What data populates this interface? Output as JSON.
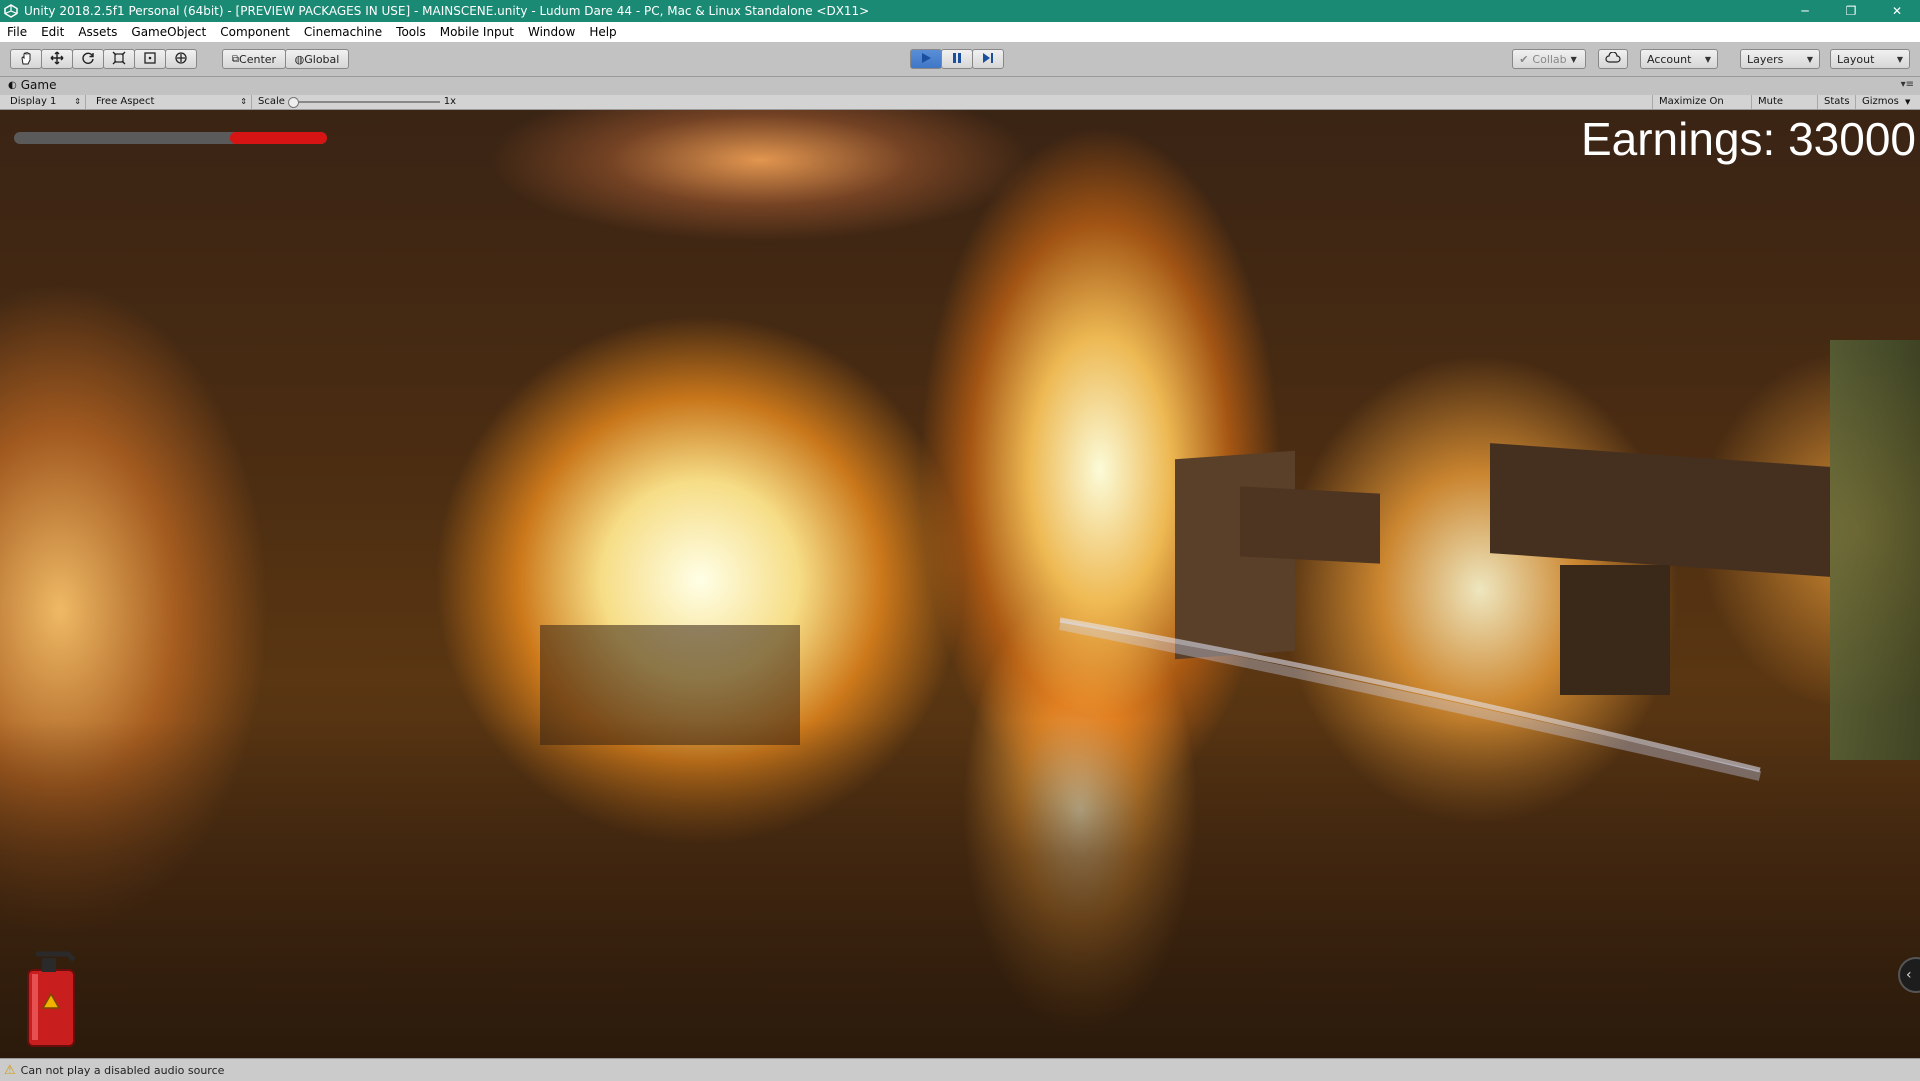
{
  "window": {
    "title": "Unity 2018.2.5f1 Personal (64bit) - [PREVIEW PACKAGES IN USE] - MAINSCENE.unity - Ludum Dare 44 - PC, Mac & Linux Standalone <DX11>",
    "minimize_glyph": "─",
    "restore_glyph": "❐",
    "close_glyph": "✕"
  },
  "menu": [
    "File",
    "Edit",
    "Assets",
    "GameObject",
    "Component",
    "Cinemachine",
    "Tools",
    "Mobile Input",
    "Window",
    "Help"
  ],
  "toolbar": {
    "pivot_label": "Center",
    "space_label": "Global",
    "collab_label": "Collab",
    "account_label": "Account",
    "layers_label": "Layers",
    "layout_label": "Layout",
    "play_state": "playing",
    "play_color": "#3f77c7"
  },
  "game_view": {
    "tab_label": "Game",
    "display": "Display 1",
    "aspect": "Free Aspect",
    "scale_label": "Scale",
    "scale_value": "1x",
    "maximize_on_play": "Maximize On Play",
    "mute_audio": "Mute Audio",
    "stats": "Stats",
    "gizmos": "Gizmos"
  },
  "hud": {
    "earnings": "Earnings: 33000",
    "health_fill_start": 0.69,
    "health_fill_end": 1.0,
    "health_color": "#d61414",
    "extinguisher_icon": "fire-extinguisher-icon"
  },
  "status": {
    "message": "Can not play a disabled audio source",
    "icon": "warning-icon"
  }
}
